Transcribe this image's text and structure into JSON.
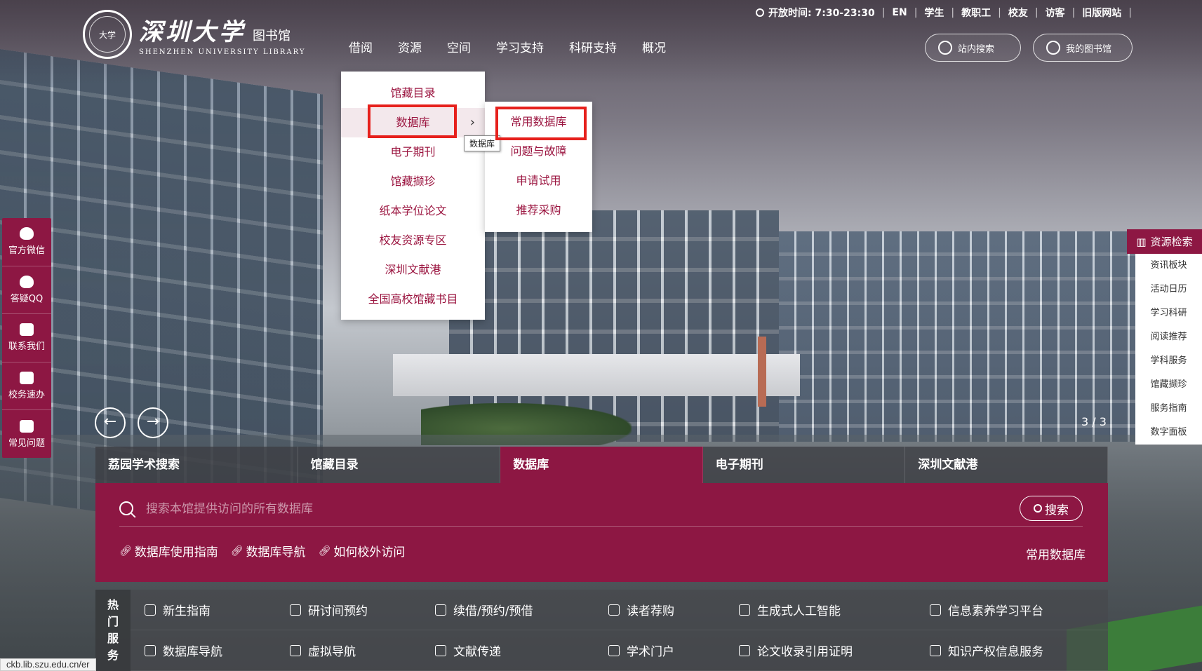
{
  "logo": {
    "seal_text": "大学",
    "name_cn": "深圳大学",
    "library_cn": "图书馆",
    "name_en": "SHENZHEN UNIVERSITY LIBRARY"
  },
  "topbar": {
    "hours": "开放时间: 7:30-23:30",
    "links": [
      "EN",
      "学生",
      "教职工",
      "校友",
      "访客",
      "旧版网站"
    ]
  },
  "mainnav": [
    "借阅",
    "资源",
    "空间",
    "学习支持",
    "科研支持",
    "概况"
  ],
  "header_buttons": {
    "site_search": "站内搜索",
    "my_library": "我的图书馆"
  },
  "dropdown": {
    "items": [
      "馆藏目录",
      "数据库",
      "电子期刊",
      "馆藏撷珍",
      "纸本学位论文",
      "校友资源专区",
      "深圳文献港",
      "全国高校馆藏书目"
    ],
    "active_index": 1,
    "submenu": [
      "常用数据库",
      "问题与故障",
      "申请试用",
      "推荐采购"
    ],
    "tooltip": "数据库"
  },
  "leftbar": [
    "官方微信",
    "答疑QQ",
    "联系我们",
    "校务速办",
    "常见问题"
  ],
  "rightbar": {
    "head": "资源检索",
    "items": [
      "资讯板块",
      "活动日历",
      "学习科研",
      "阅读推荐",
      "学科服务",
      "馆藏撷珍",
      "服务指南",
      "数字面板"
    ]
  },
  "carousel": {
    "prev": "←",
    "next": "→",
    "counter": "3 / 3"
  },
  "search": {
    "tabs": [
      "荔园学术搜索",
      "馆藏目录",
      "数据库",
      "电子期刊",
      "深圳文献港"
    ],
    "active_tab": 2,
    "placeholder": "搜索本馆提供访问的所有数据库",
    "button": "搜索",
    "links": [
      "数据库使用指南",
      "数据库导航",
      "如何校外访问"
    ],
    "common_db": "常用数据库"
  },
  "hot_services": {
    "label": [
      "热",
      "门",
      "服",
      "务"
    ],
    "row1": [
      "新生指南",
      "研讨间预约",
      "续借/预约/预借",
      "读者荐购",
      "生成式人工智能",
      "信息素养学习平台"
    ],
    "row2": [
      "数据库导航",
      "虚拟导航",
      "文献传递",
      "学术门户",
      "论文收录引用证明",
      "知识产权信息服务"
    ]
  },
  "status_url": "ckb.lib.szu.edu.cn/er",
  "colors": {
    "brand": "#8d1743",
    "highlight": "#e6201c",
    "menu_text": "#9b1540"
  }
}
